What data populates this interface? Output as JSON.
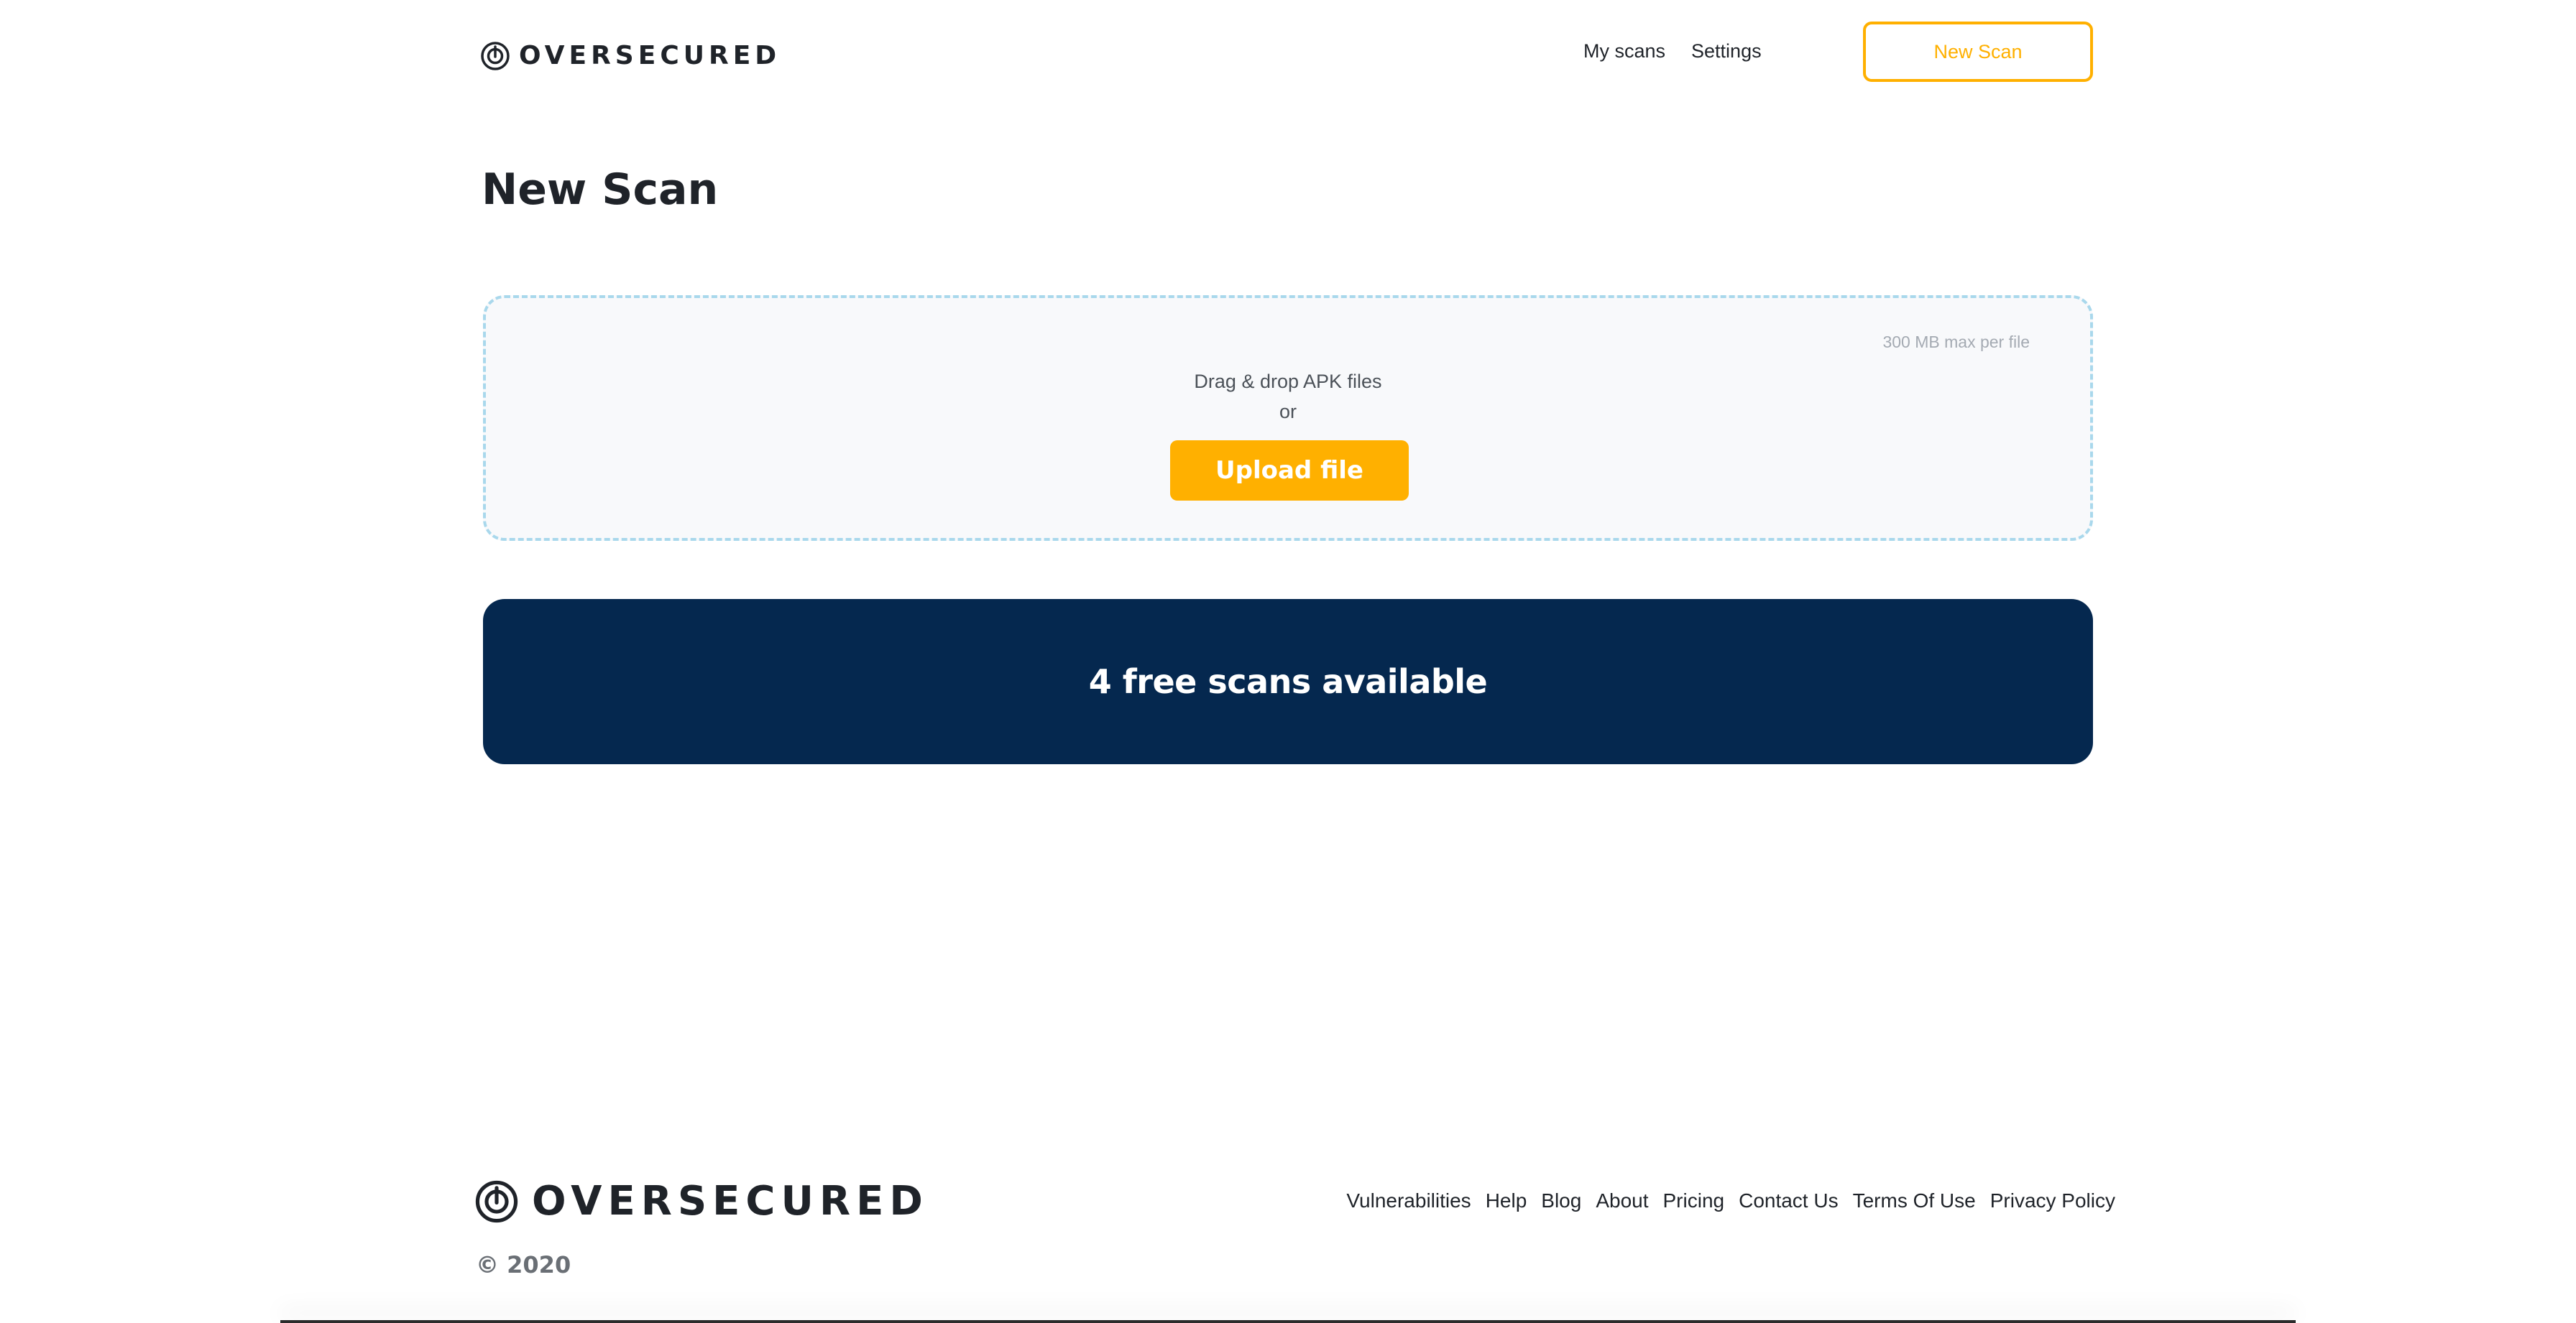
{
  "header": {
    "brand": "OVERSECURED",
    "nav": [
      {
        "label": "My scans"
      },
      {
        "label": "Settings"
      }
    ],
    "new_scan_label": "New Scan"
  },
  "main": {
    "title": "New Scan",
    "dropzone": {
      "limit": "300 MB max per file",
      "drag_text": "Drag & drop APK files",
      "or_text": "or",
      "upload_label": "Upload file"
    },
    "free_scans": "4 free scans available"
  },
  "footer": {
    "brand": "OVERSECURED",
    "copyright": "© 2020",
    "links": [
      {
        "label": "Vulnerabilities"
      },
      {
        "label": "Help"
      },
      {
        "label": "Blog"
      },
      {
        "label": "About"
      },
      {
        "label": "Pricing"
      },
      {
        "label": "Contact Us"
      },
      {
        "label": "Terms Of Use"
      },
      {
        "label": "Privacy Policy"
      }
    ]
  },
  "colors": {
    "accent": "#ffb000",
    "navy": "#05284f",
    "dropzone_border": "#a9d8ec"
  },
  "icons": {
    "brand_logo": "oversecured-logo-icon"
  }
}
